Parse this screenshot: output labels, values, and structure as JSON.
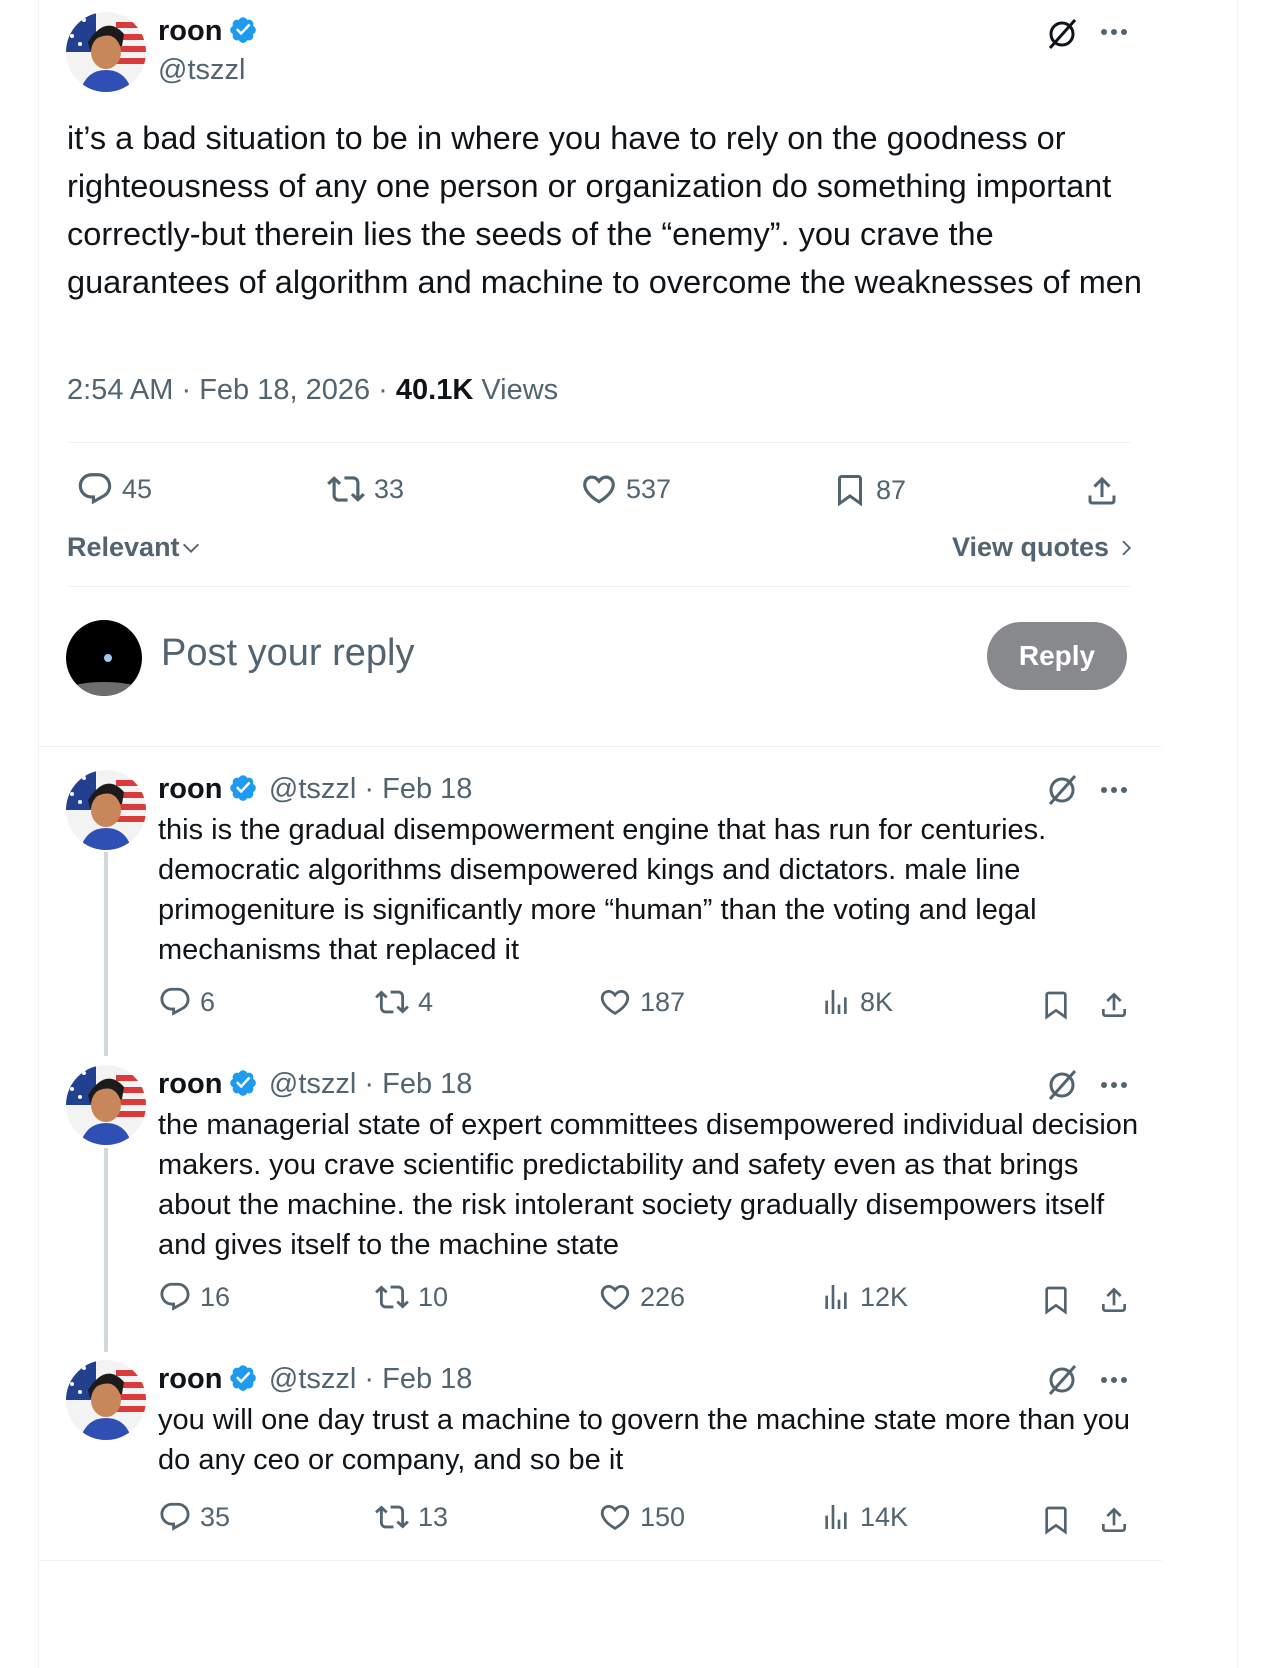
{
  "main_post": {
    "author_name": "roon",
    "author_handle": "@tszzl",
    "text": "it’s a bad situation to be in where you have to rely on the goodness or righteousness of any one person or organization do something important correctly-but therein lies the seeds of the “enemy”. you crave the guarantees of algorithm and machine to overcome the weaknesses of men",
    "time": "2:54 AM",
    "date": "Feb 18, 2026",
    "views_count": "40.1K",
    "views_label": "Views",
    "replies": "45",
    "reposts": "33",
    "likes": "537",
    "bookmarks": "87"
  },
  "sort": {
    "label": "Relevant",
    "view_quotes": "View quotes"
  },
  "composer": {
    "placeholder": "Post your reply",
    "reply_button": "Reply"
  },
  "replies": [
    {
      "author_name": "roon",
      "author_handle": "@tszzl",
      "date": "Feb 18",
      "text": "this is the gradual disempowerment engine that has run for centuries. democratic algorithms disempowered kings and dictators. male line primogeniture is significantly more “human” than the voting and legal mechanisms that replaced it",
      "replies": "6",
      "reposts": "4",
      "likes": "187",
      "views": "8K"
    },
    {
      "author_name": "roon",
      "author_handle": "@tszzl",
      "date": "Feb 18",
      "text": "the managerial state of expert committees disempowered individual decision makers. you crave scientific predictability and safety even as that brings about the machine. the risk intolerant society gradually disempowers itself and gives itself to the machine state",
      "replies": "16",
      "reposts": "10",
      "likes": "226",
      "views": "12K"
    },
    {
      "author_name": "roon",
      "author_handle": "@tszzl",
      "date": "Feb 18",
      "text": "you will one day trust a machine to govern the machine state more than you do any ceo or company, and so be it",
      "replies": "35",
      "reposts": "13",
      "likes": "150",
      "views": "14K"
    }
  ],
  "icons": {
    "verified": "verified-badge-icon",
    "grok": "grok-icon",
    "more": "more-icon",
    "reply": "reply-icon",
    "repost": "repost-icon",
    "like": "like-icon",
    "bookmark": "bookmark-icon",
    "share": "share-icon",
    "views": "views-icon"
  },
  "colors": {
    "accent": "#1d9bf0",
    "secondary_text": "#536471",
    "reply_button": "#87898c"
  }
}
